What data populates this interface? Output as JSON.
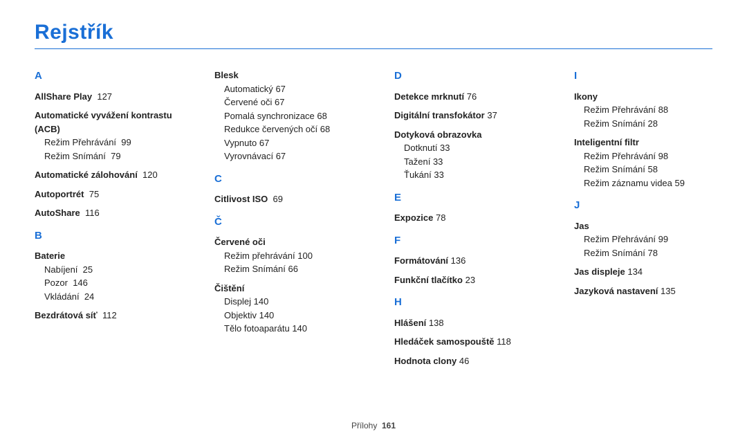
{
  "title": "Rejstřík",
  "footer": {
    "label": "Přílohy",
    "page": "161"
  },
  "col1": {
    "A": {
      "letter": "A",
      "e1": {
        "label": "AllShare Play",
        "page": "127"
      },
      "e2": {
        "label": "Automatické vyvážení kontrastu (ACB)"
      },
      "e2s1": {
        "label": "Režim Přehrávání",
        "page": "99"
      },
      "e2s2": {
        "label": "Režim Snímání",
        "page": "79"
      },
      "e3": {
        "label": "Automatické zálohování",
        "page": "120"
      },
      "e4": {
        "label": "Autoportrét",
        "page": "75"
      },
      "e5": {
        "label": "AutoShare",
        "page": "116"
      }
    },
    "B": {
      "letter": "B",
      "e1": {
        "label": "Baterie"
      },
      "e1s1": {
        "label": "Nabíjení",
        "page": "25"
      },
      "e1s2": {
        "label": "Pozor",
        "page": "146"
      },
      "e1s3": {
        "label": "Vkládání",
        "page": "24"
      },
      "e2": {
        "label": "Bezdrátová síť",
        "page": "112"
      }
    }
  },
  "col2": {
    "Blesk": {
      "label": "Blesk",
      "s1": {
        "label": "Automatický",
        "page": "67"
      },
      "s2": {
        "label": "Červené oči",
        "page": "67"
      },
      "s3": {
        "label": "Pomalá synchronizace",
        "page": "68"
      },
      "s4": {
        "label": "Redukce červených očí",
        "page": "68"
      },
      "s5": {
        "label": "Vypnuto",
        "page": "67"
      },
      "s6": {
        "label": "Vyrovnávací",
        "page": "67"
      }
    },
    "C": {
      "letter": "C",
      "e1": {
        "label": "Citlivost ISO",
        "page": "69"
      }
    },
    "Cc": {
      "letter": "Č",
      "e1": {
        "label": "Červené oči"
      },
      "e1s1": {
        "label": "Režim přehrávání",
        "page": "100"
      },
      "e1s2": {
        "label": "Režim Snímání",
        "page": "66"
      },
      "e2": {
        "label": "Čištění"
      },
      "e2s1": {
        "label": "Displej",
        "page": "140"
      },
      "e2s2": {
        "label": "Objektiv",
        "page": "140"
      },
      "e2s3": {
        "label": "Tělo fotoaparátu",
        "page": "140"
      }
    }
  },
  "col3": {
    "D": {
      "letter": "D",
      "e1": {
        "label": "Detekce mrknutí",
        "page": "76"
      },
      "e2": {
        "label": "Digitální transfokátor",
        "page": "37"
      },
      "e3": {
        "label": "Dotyková obrazovka"
      },
      "e3s1": {
        "label": "Dotknutí",
        "page": "33"
      },
      "e3s2": {
        "label": "Tažení",
        "page": "33"
      },
      "e3s3": {
        "label": "Ťukání",
        "page": "33"
      }
    },
    "E": {
      "letter": "E",
      "e1": {
        "label": "Expozice",
        "page": "78"
      }
    },
    "F": {
      "letter": "F",
      "e1": {
        "label": "Formátování",
        "page": "136"
      },
      "e2": {
        "label": "Funkční tlačítko",
        "page": "23"
      }
    },
    "H": {
      "letter": "H",
      "e1": {
        "label": "Hlášení",
        "page": "138"
      },
      "e2": {
        "label": "Hledáček samospouště",
        "page": "118"
      },
      "e3": {
        "label": "Hodnota clony",
        "page": "46"
      }
    }
  },
  "col4": {
    "I": {
      "letter": "I",
      "e1": {
        "label": "Ikony"
      },
      "e1s1": {
        "label": "Režim Přehrávání",
        "page": "88"
      },
      "e1s2": {
        "label": "Režim Snímání",
        "page": "28"
      },
      "e2": {
        "label": "Inteligentní filtr"
      },
      "e2s1": {
        "label": "Režim Přehrávání",
        "page": "98"
      },
      "e2s2": {
        "label": "Režim Snímání",
        "page": "58"
      },
      "e2s3": {
        "label": "Režim záznamu videa",
        "page": "59"
      }
    },
    "J": {
      "letter": "J",
      "e1": {
        "label": "Jas"
      },
      "e1s1": {
        "label": "Režim Přehrávání",
        "page": "99"
      },
      "e1s2": {
        "label": "Režim Snímání",
        "page": "78"
      },
      "e2": {
        "label": "Jas displeje",
        "page": "134"
      },
      "e3": {
        "label": "Jazyková nastavení",
        "page": "135"
      }
    }
  }
}
